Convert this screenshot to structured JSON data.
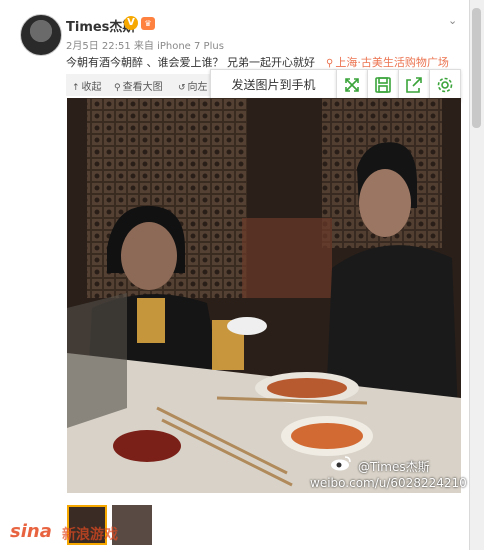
{
  "user": {
    "name": "Times杰斯",
    "verified_mark": "V",
    "level_mark": "♛",
    "meta": "2月5日 22:51 来自 iPhone 7 Plus"
  },
  "post": {
    "text": "今朝有酒今朝醉 、谁会爱上谁？ 兄弟一起开心就好",
    "location": "上海·古美生活购物广场"
  },
  "image_toolbar": {
    "collapse": "收起",
    "view_large": "查看大图",
    "rotate_left": "向左",
    "send_to_phone": "发送图片到手机",
    "icons": [
      "fullscreen-icon",
      "save-icon",
      "share-icon",
      "settings-icon"
    ]
  },
  "watermark": {
    "handle": "@Times杰斯",
    "url": "weibo.com/u/6028224210"
  },
  "site_watermark": {
    "logo": "sina",
    "label": "新浪游戏"
  },
  "colors": {
    "accent_green": "#3aa43a",
    "location_orange": "#eb7350",
    "verify_gold": "#f7a800"
  }
}
